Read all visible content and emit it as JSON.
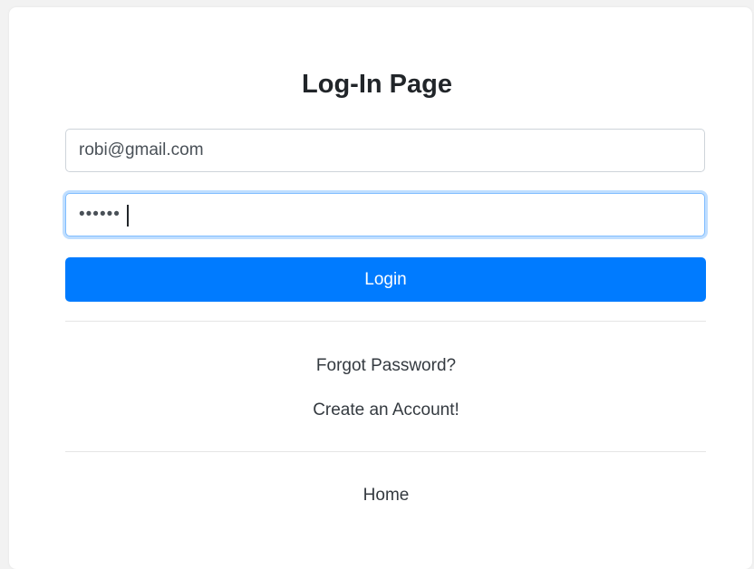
{
  "page": {
    "title": "Log-In Page"
  },
  "form": {
    "email_value": "robi@gmail.com",
    "password_value": "••••••",
    "login_label": "Login"
  },
  "links": {
    "forgot_password": "Forgot Password?",
    "create_account": "Create an Account!",
    "home": "Home"
  },
  "colors": {
    "primary": "#007bff",
    "focus_border": "#80bdff",
    "text": "#343a40"
  }
}
